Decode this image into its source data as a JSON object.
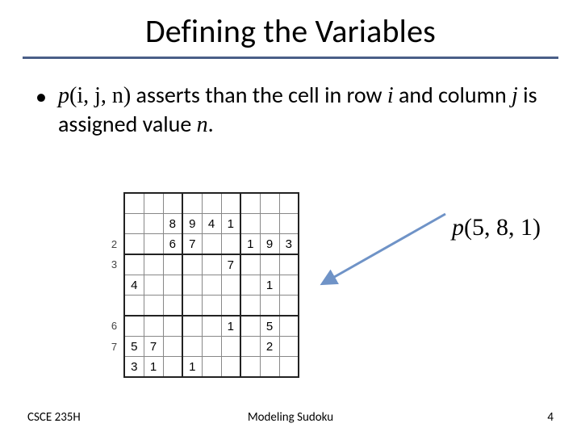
{
  "title": "Defining the Variables",
  "bullet": {
    "dot": "•",
    "p_ijn_prefix": "p",
    "p_ijn_args": "(i, j, n)",
    "text1": " asserts than the cell in row ",
    "var_i": "i",
    "text2": " and column ",
    "var_j": "j",
    "text3": " is assigned value ",
    "var_n": "n",
    "text4": "."
  },
  "example": {
    "p_prefix": "p",
    "p_args": "(5, 8, 1)"
  },
  "sudoku": {
    "col_headers": [
      "",
      "",
      "",
      "",
      "",
      "",
      "",
      "",
      ""
    ],
    "row_headers": [
      "",
      "",
      "2",
      "3",
      "",
      "",
      "6",
      "7",
      ""
    ],
    "cells": [
      [
        "",
        "",
        "",
        "",
        "",
        "",
        "",
        "",
        ""
      ],
      [
        "",
        "",
        "8",
        "9",
        "4",
        "1",
        "",
        "",
        ""
      ],
      [
        "",
        "",
        "6",
        "7",
        "",
        "",
        "1",
        "9",
        "3"
      ],
      [
        "",
        "",
        "",
        "",
        "",
        "7",
        "",
        "",
        ""
      ],
      [
        "4",
        "",
        "",
        "",
        "",
        "",
        "",
        "1",
        ""
      ],
      [
        "",
        "",
        "",
        "",
        "",
        "",
        "",
        "",
        ""
      ],
      [
        "",
        "",
        "",
        "",
        "",
        "1",
        "",
        "5",
        ""
      ],
      [
        "5",
        "7",
        "",
        "",
        "",
        "",
        "",
        "2",
        ""
      ],
      [
        "3",
        "1",
        "",
        "1",
        "",
        "",
        "",
        "",
        ""
      ]
    ]
  },
  "footer": {
    "left": "CSCE 235H",
    "center": "Modeling Sudoku",
    "page": "4"
  }
}
